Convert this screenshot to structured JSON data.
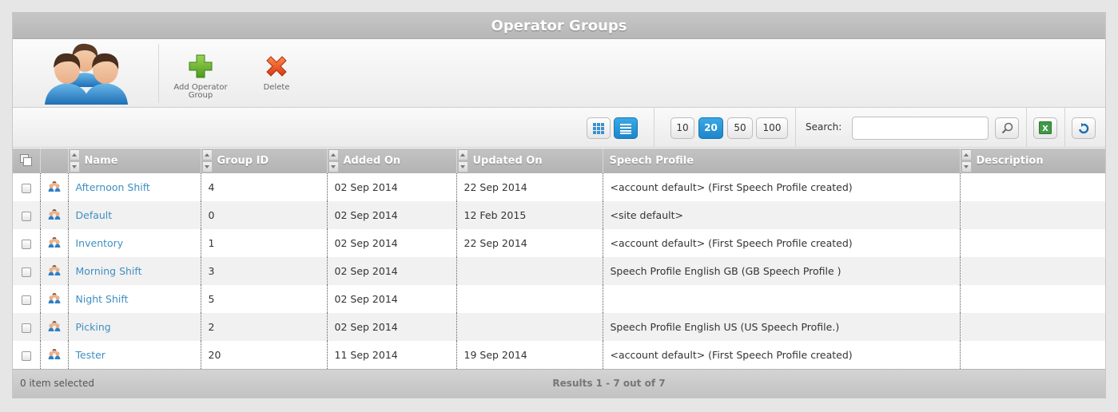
{
  "title": "Operator Groups",
  "toolbar": {
    "add_label": "Add Operator Group",
    "delete_label": "Delete"
  },
  "view_toggle": {
    "active": "list"
  },
  "page_sizes": [
    "10",
    "20",
    "50",
    "100"
  ],
  "page_size_selected": "20",
  "search": {
    "label": "Search:",
    "value": "",
    "placeholder": ""
  },
  "columns": {
    "name": "Name",
    "group_id": "Group ID",
    "added_on": "Added On",
    "updated_on": "Updated On",
    "speech_profile": "Speech Profile",
    "description": "Description"
  },
  "rows": [
    {
      "name": "Afternoon Shift",
      "group_id": "4",
      "added_on": "02 Sep 2014",
      "updated_on": "22 Sep 2014",
      "speech_profile": "<account default> (First Speech Profile created)",
      "description": ""
    },
    {
      "name": "Default",
      "group_id": "0",
      "added_on": "02 Sep 2014",
      "updated_on": "12 Feb 2015",
      "speech_profile": "<site default>",
      "description": ""
    },
    {
      "name": "Inventory",
      "group_id": "1",
      "added_on": "02 Sep 2014",
      "updated_on": "22 Sep 2014",
      "speech_profile": "<account default> (First Speech Profile created)",
      "description": ""
    },
    {
      "name": "Morning Shift",
      "group_id": "3",
      "added_on": "02 Sep 2014",
      "updated_on": "",
      "speech_profile": "Speech Profile English GB (GB Speech Profile )",
      "description": ""
    },
    {
      "name": "Night Shift",
      "group_id": "5",
      "added_on": "02 Sep 2014",
      "updated_on": "",
      "speech_profile": "",
      "description": ""
    },
    {
      "name": "Picking",
      "group_id": "2",
      "added_on": "02 Sep 2014",
      "updated_on": "",
      "speech_profile": "Speech Profile English US (US Speech Profile.)",
      "description": ""
    },
    {
      "name": "Tester",
      "group_id": "20",
      "added_on": "11 Sep 2014",
      "updated_on": "19 Sep 2014",
      "speech_profile": "<account default> (First Speech Profile created)",
      "description": ""
    }
  ],
  "footer": {
    "selected_text": "0 item selected",
    "results_text": "Results 1 - 7 out of 7"
  },
  "colors": {
    "accent": "#1d86c9",
    "link": "#3f8fc4",
    "header": "#b7b7b7"
  }
}
